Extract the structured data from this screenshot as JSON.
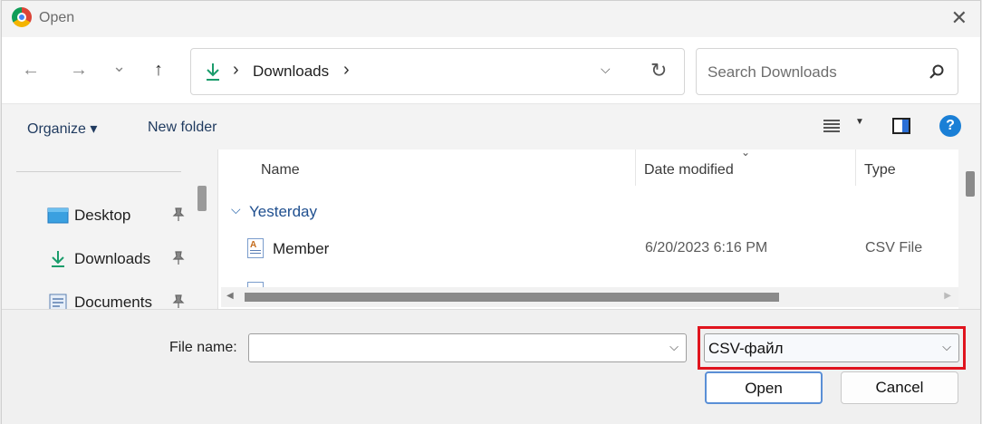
{
  "window": {
    "title": "Open",
    "close_glyph": "✕"
  },
  "nav": {
    "back_glyph": "←",
    "forward_glyph": "→",
    "recent_glyph": "⌄",
    "up_glyph": "↑",
    "address_sep": "›",
    "address_path": "Downloads",
    "refresh_glyph": "↻",
    "dropdown_glyph": "⌵"
  },
  "search": {
    "placeholder": "Search Downloads"
  },
  "toolbar": {
    "organize_label": "Organize ▾",
    "new_folder_label": "New folder",
    "view_dropdown_glyph": "▼",
    "help_glyph": "?"
  },
  "sidebar": {
    "items": [
      {
        "label": "Desktop",
        "icon": "desktop-icon"
      },
      {
        "label": "Downloads",
        "icon": "download-icon"
      },
      {
        "label": "Documents",
        "icon": "documents-icon"
      }
    ],
    "pin_glyph": "📌"
  },
  "filelist": {
    "columns": [
      "Name",
      "Date modified",
      "Type"
    ],
    "sort_glyph": "⌄",
    "group_chevron": "⌵",
    "groups": [
      {
        "label": "Yesterday",
        "rows": [
          {
            "name": "Member",
            "date": "6/20/2023 6:16 PM",
            "type": "CSV File"
          }
        ]
      }
    ]
  },
  "bottom": {
    "file_name_label": "File name:",
    "file_name_value": "",
    "file_type_value": "CSV-файл",
    "chevron_glyph": "⌵",
    "open_label": "Open",
    "cancel_label": "Cancel"
  },
  "colors": {
    "accent": "#1a7fd6",
    "highlight": "#e0141e"
  }
}
